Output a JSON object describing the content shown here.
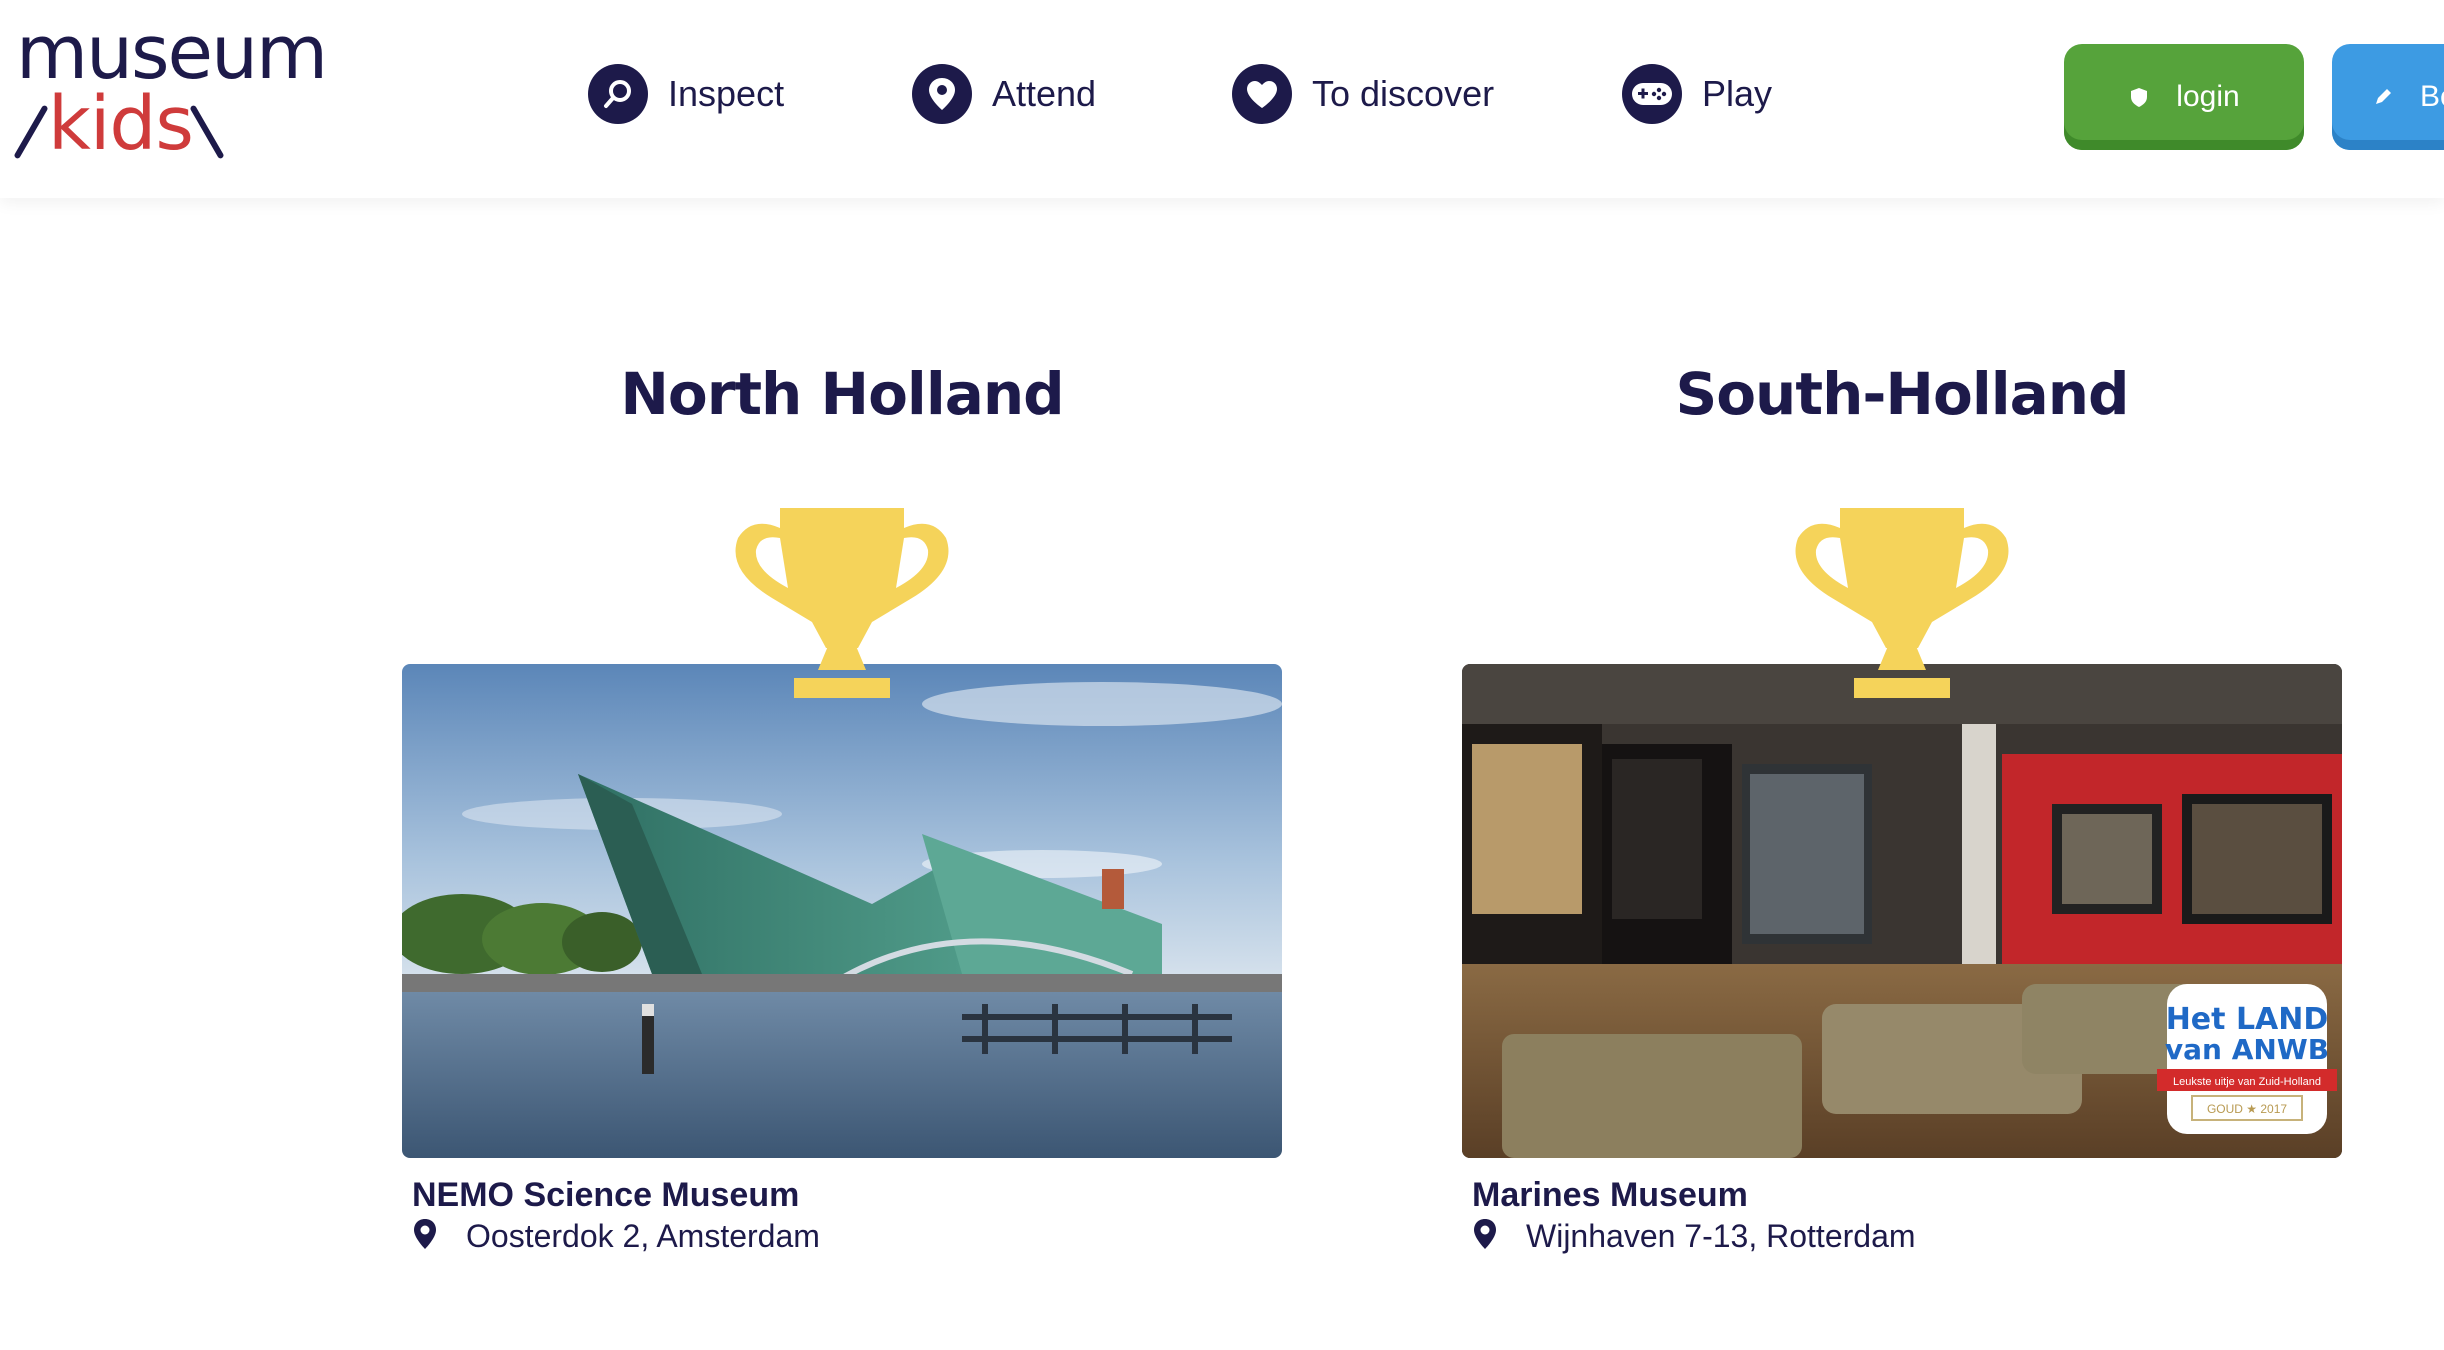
{
  "logo": {
    "top": "museum",
    "bottom": "kids"
  },
  "nav": [
    {
      "label": "Inspect",
      "icon": "search-icon"
    },
    {
      "label": "Attend",
      "icon": "location-pin-icon"
    },
    {
      "label": "To discover",
      "icon": "heart-icon"
    },
    {
      "label": "Play",
      "icon": "gamepad-icon"
    }
  ],
  "buttons": {
    "login_label": "login",
    "register_label": "Be"
  },
  "colors": {
    "navy": "#1d1a4a",
    "login_green": "#56a33b",
    "register_blue": "#3d9be3",
    "trophy_gold": "#f5d35a",
    "logo_red": "#cf3b3b"
  },
  "regions": [
    {
      "title": "North Holland",
      "museum": "NEMO Science Museum",
      "address": "Oosterdok 2, Amsterdam"
    },
    {
      "title": "South-Holland",
      "museum": "Marines Museum",
      "address": "Wijnhaven 7-13, Rotterdam",
      "badge": {
        "line1": "Het LAND",
        "line2": "van ANWB",
        "ribbon": "Leukste uitje van Zuid-Holland",
        "award": "GOUD ★ 2017"
      }
    }
  ]
}
